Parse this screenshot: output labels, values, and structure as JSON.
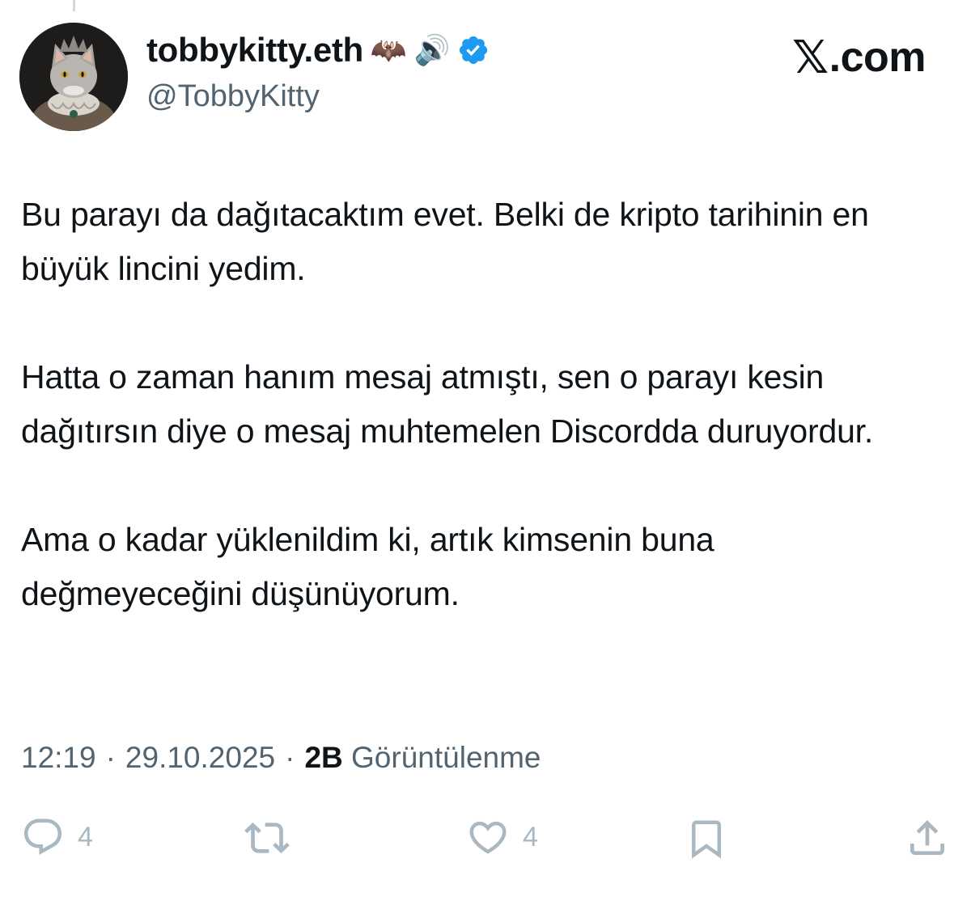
{
  "author": {
    "display_name": "tobbykitty.eth",
    "handle": "@TobbyKitty",
    "name_emojis": [
      "🦇",
      "🔊"
    ],
    "verified_icon": "verified-badge-icon",
    "avatar_icon": "cat-portrait-avatar"
  },
  "brand": {
    "x_glyph": "𝕏",
    "text": ".com"
  },
  "tweet": {
    "paragraphs": [
      "Bu parayı da dağıtacaktım evet. Belki de kripto tarihinin en büyük lincini yedim.",
      "Hatta o zaman hanım mesaj atmıştı, sen o parayı kesin dağıtırsın diye o mesaj muhtemelen Discordda duruyordur.",
      "Ama o kadar yüklenildim ki, artık kimsenin buna değmeyeceğini düşünüyorum."
    ],
    "time": "12:19",
    "separator": "·",
    "date": "29.10.2025",
    "views_count": "2B",
    "views_label": "Görüntülenme"
  },
  "actions": {
    "reply": {
      "icon": "reply-icon",
      "count": "4"
    },
    "retweet": {
      "icon": "retweet-icon",
      "count": ""
    },
    "like": {
      "icon": "heart-icon",
      "count": "4"
    },
    "bookmark": {
      "icon": "bookmark-icon",
      "count": ""
    },
    "share": {
      "icon": "share-icon",
      "count": ""
    }
  },
  "colors": {
    "text_primary": "#0f1419",
    "text_secondary": "#536471",
    "action_icons": "#aab8c2",
    "verified_blue": "#1d9bf0",
    "background": "#ffffff"
  }
}
